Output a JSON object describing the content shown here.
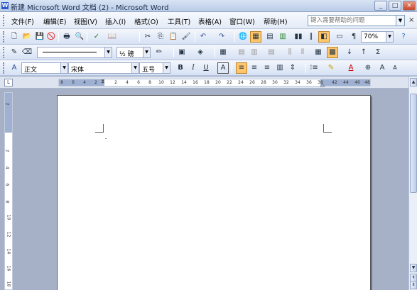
{
  "window": {
    "title": "新建 Microsoft Word 文档 (2) - Microsoft Word",
    "app_icon": "W",
    "controls": {
      "minimize": "_",
      "maximize": "□",
      "close": "×"
    }
  },
  "menubar": {
    "items": [
      "文件(F)",
      "编辑(E)",
      "视图(V)",
      "插入(I)",
      "格式(O)",
      "工具(T)",
      "表格(A)",
      "窗口(W)",
      "帮助(H)"
    ],
    "help_placeholder": "键入需要帮助的问题",
    "doc_close": "×"
  },
  "standard_toolbar": {
    "icons": [
      "new-doc-icon",
      "open-folder-icon",
      "save-icon",
      "permission-icon",
      "print-icon",
      "print-preview-icon",
      "spelling-icon",
      "research-icon",
      "cut-icon",
      "copy-icon",
      "paste-icon",
      "format-painter-icon",
      "undo-icon",
      "redo-icon",
      "hyperlink-icon",
      "tables-borders-icon",
      "insert-table-icon",
      "insert-excel-icon",
      "columns-icon",
      "drawing-icon",
      "document-map-icon",
      "show-hide-icon",
      "read-icon"
    ],
    "zoom": "70%"
  },
  "tables_toolbar": {
    "line_weight": "½ 磅",
    "icons": [
      "draw-table-icon",
      "eraser-icon",
      "border-color-icon",
      "outside-border-icon",
      "shading-icon",
      "insert-table-icon",
      "merge-cells-icon",
      "split-cells-icon",
      "align-icon",
      "distribute-rows-icon",
      "distribute-cols-icon",
      "autoformat-icon",
      "sort-asc-icon",
      "sort-desc-icon",
      "autosum-icon"
    ]
  },
  "formatting_toolbar": {
    "style": "正文",
    "font": "宋体",
    "size": "五号",
    "bold": "B",
    "italic": "I",
    "underline": "U",
    "char_border": "A",
    "font_color_letter": "A",
    "grow_font": "A",
    "shrink_font": "A"
  },
  "ruler": {
    "corner": "L",
    "ticks": [
      "8",
      "6",
      "4",
      "2",
      "2",
      "4",
      "6",
      "8",
      "10",
      "12",
      "14",
      "16",
      "18",
      "20",
      "22",
      "24",
      "26",
      "28",
      "30",
      "32",
      "34",
      "36",
      "38",
      "42",
      "44",
      "46",
      "48"
    ]
  },
  "vertical_ruler": {
    "ticks": [
      "2",
      "2",
      "4",
      "6",
      "8",
      "10",
      "12",
      "14",
      "16",
      "18"
    ]
  },
  "scrollbar": {
    "up": "▲",
    "down": "▼"
  }
}
